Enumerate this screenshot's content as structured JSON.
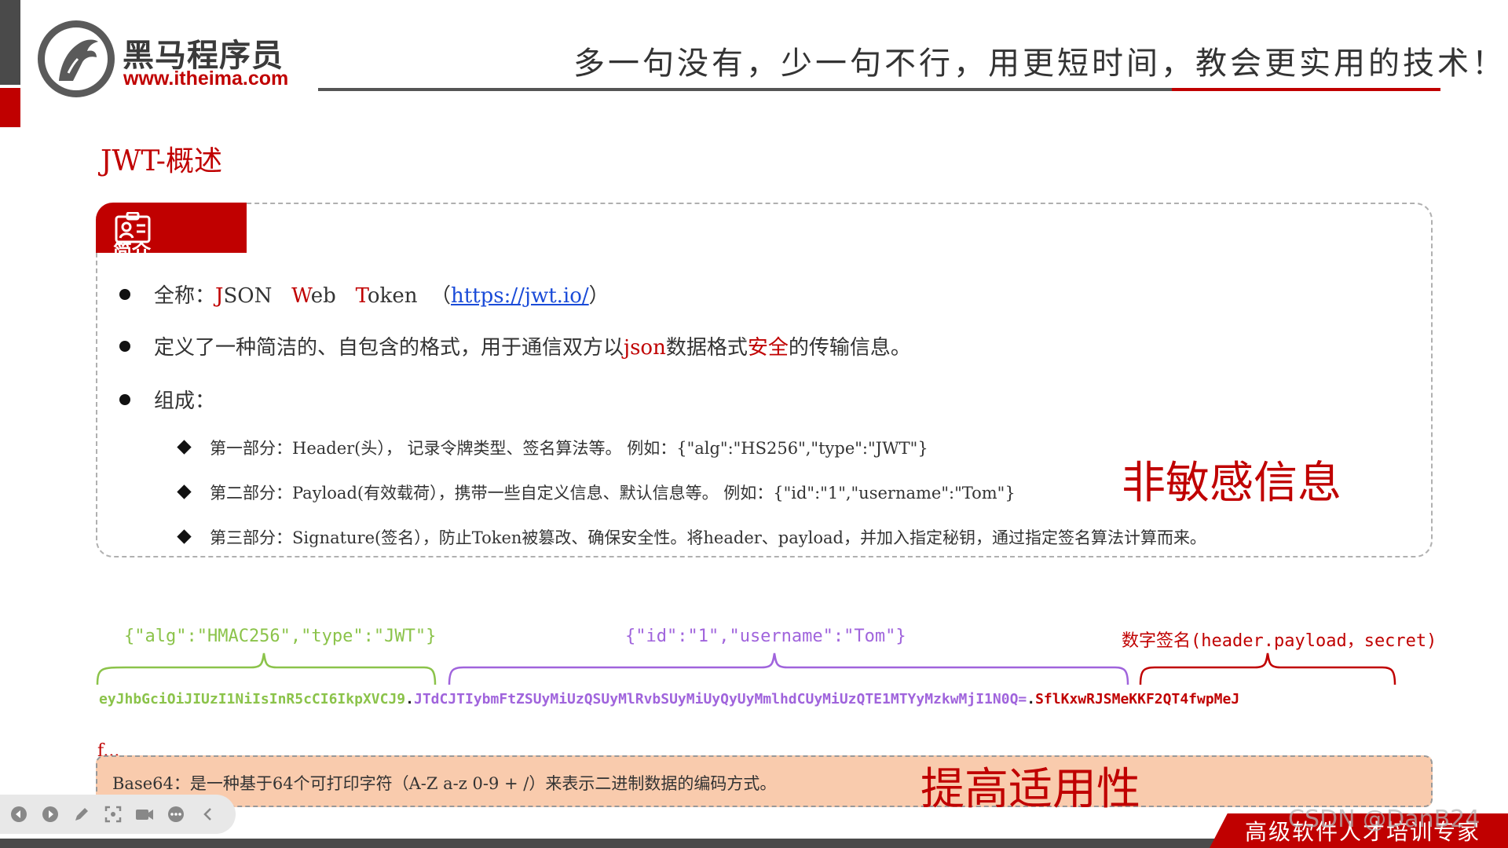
{
  "header": {
    "logo_cn": "黑马程序员",
    "logo_url": "www.itheima.com",
    "slogan": "多一句没有，少一句不行，用更短时间，教会更实用的技术！"
  },
  "page_title": "JWT-概述",
  "intro": {
    "tab_label": "简介",
    "fullname_label": "全称：",
    "fullname_j": "J",
    "fullname_son": "SON",
    "fullname_w": "W",
    "fullname_eb": "eb",
    "fullname_t": "T",
    "fullname_oken": "oken",
    "link_open": "（",
    "link": "https://jwt.io/",
    "link_close": "）",
    "def_prefix": "定义了一种简洁的、自包含的格式，用于通信双方以",
    "def_json": "json",
    "def_middle": "数据格式",
    "def_secure": "安全",
    "def_suffix": "的传输信息。",
    "composition_label": "组成：",
    "parts": [
      "第一部分：Header(头），  记录令牌类型、签名算法等。 例如：{\"alg\":\"HS256\",\"type\":\"JWT\"}",
      "第二部分：Payload(有效载荷），携带一些自定义信息、默认信息等。 例如：{\"id\":\"1\",\"username\":\"Tom\"}",
      "第三部分：Signature(签名），防止Token被篡改、确保安全性。将header、payload，并加入指定秘钥，通过指定签名算法计算而来。"
    ],
    "non_sensitive": "非敏感信息"
  },
  "token": {
    "header_json": "{\"alg\":\"HMAC256\",\"type\":\"JWT\"}",
    "payload_json": "{\"id\":\"1\",\"username\":\"Tom\"}",
    "signature_cn": "数字签名",
    "signature_formula": "(header.payload，secret)",
    "part1": "eyJhbGciOiJIUzI1NiIsInR5cCI6IkpXVCJ9",
    "dot": ".",
    "part2": "JTdCJTIybmFtZSUyMiUzQSUyMlRvbSUyMiUyQyUyMmlhdCUyMiUzQTE1MTYyMzkwMjI1N0Q=",
    "part3": "SflKxwRJSMeKKF2QT4fwpMeJ",
    "stub": "f..."
  },
  "base64": {
    "text": "Base64：是一种基于64个可打印字符（A-Z  a-z  0-9  +  /）来表示二进制数据的编码方式。",
    "highlight": "提高适用性"
  },
  "footer": {
    "tagline": "高级软件人才培训专家",
    "watermark": "CSDN @DanB24"
  },
  "colors": {
    "brand_red": "#c00000",
    "header_green": "#8bc34a",
    "payload_purple": "#a064dc",
    "base64_bg": "#f9cbad"
  },
  "toolbar_icons": [
    "prev-icon",
    "next-icon",
    "pen-icon",
    "zoom-icon",
    "camera-icon",
    "more-icon",
    "collapse-icon"
  ]
}
